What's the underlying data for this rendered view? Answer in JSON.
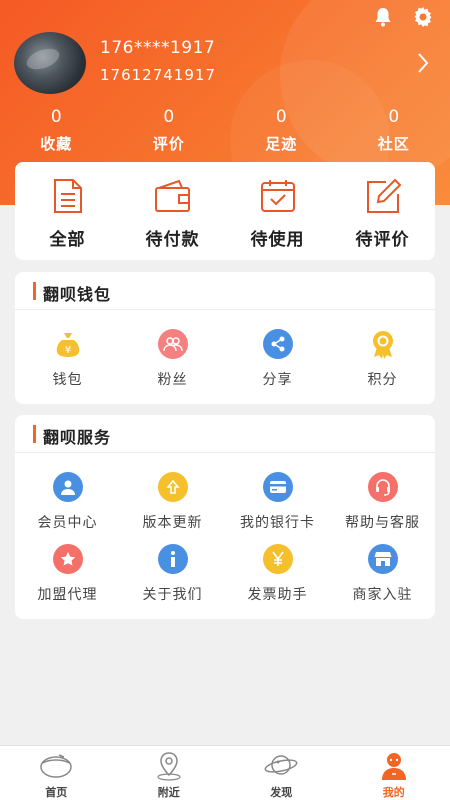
{
  "profile": {
    "name": "176****1917",
    "phone": "17612741917"
  },
  "stats": [
    {
      "value": "0",
      "label": "收藏"
    },
    {
      "value": "0",
      "label": "评价"
    },
    {
      "value": "0",
      "label": "足迹"
    },
    {
      "value": "0",
      "label": "社区"
    }
  ],
  "orders": [
    {
      "label": "全部",
      "icon": "document-icon"
    },
    {
      "label": "待付款",
      "icon": "wallet-icon"
    },
    {
      "label": "待使用",
      "icon": "calendar-check-icon"
    },
    {
      "label": "待评价",
      "icon": "edit-icon"
    }
  ],
  "wallet": {
    "title": "翻呗钱包",
    "items": [
      {
        "label": "钱包",
        "icon": "money-bag-icon",
        "color": "#f6c02d"
      },
      {
        "label": "粉丝",
        "icon": "fans-icon",
        "color": "#f48080"
      },
      {
        "label": "分享",
        "icon": "share-icon",
        "color": "#4a90e2"
      },
      {
        "label": "积分",
        "icon": "badge-icon",
        "color": "#f6c02d"
      }
    ]
  },
  "service": {
    "title": "翻呗服务",
    "items": [
      {
        "label": "会员中心",
        "icon": "member-icon",
        "color": "#4a90e2"
      },
      {
        "label": "版本更新",
        "icon": "upload-icon",
        "color": "#f6c02d"
      },
      {
        "label": "我的银行卡",
        "icon": "bank-card-icon",
        "color": "#4a90e2"
      },
      {
        "label": "帮助与客服",
        "icon": "headset-icon",
        "color": "#f47068"
      },
      {
        "label": "加盟代理",
        "icon": "star-icon",
        "color": "#f47068"
      },
      {
        "label": "关于我们",
        "icon": "info-icon",
        "color": "#4a90e2"
      },
      {
        "label": "发票助手",
        "icon": "yen-icon",
        "color": "#f6c02d"
      },
      {
        "label": "商家入驻",
        "icon": "shop-icon",
        "color": "#4a90e2"
      }
    ]
  },
  "tabs": [
    {
      "label": "首页",
      "icon": "home-icon",
      "active": false
    },
    {
      "label": "附近",
      "icon": "location-icon",
      "active": false
    },
    {
      "label": "发现",
      "icon": "planet-icon",
      "active": false
    },
    {
      "label": "我的",
      "icon": "profile-icon",
      "active": true
    }
  ],
  "colors": {
    "accent": "#f26522",
    "header_start": "#f55a24",
    "header_end": "#f98c3c"
  }
}
